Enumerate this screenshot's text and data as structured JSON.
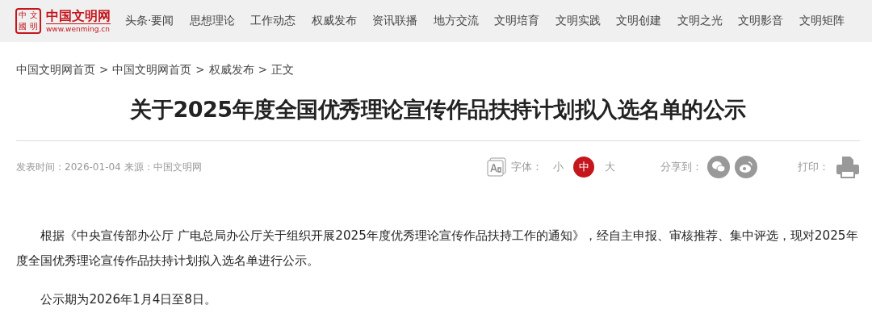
{
  "logo": {
    "seal": [
      "中",
      "文",
      "國",
      "明"
    ],
    "name": "中国文明网",
    "url": "www.wenming.cn"
  },
  "nav": [
    "头条·要闻",
    "思想理论",
    "工作动态",
    "权威发布",
    "资讯联播",
    "地方交流",
    "文明培育",
    "文明实践",
    "文明创建",
    "文明之光",
    "文明影音",
    "文明矩阵"
  ],
  "breadcrumb": [
    "中国文明网首页",
    "中国文明网首页",
    "权威发布",
    "正文"
  ],
  "breadcrumb_separator": ">",
  "title": "关于2025年度全国优秀理论宣传作品扶持计划拟入选名单的公示",
  "meta": "发表时间：2026-01-04 来源：中国文明网",
  "font_size": {
    "label": "字体：",
    "options": [
      {
        "label": "小",
        "selected": false
      },
      {
        "label": "中",
        "selected": true
      },
      {
        "label": "大",
        "selected": false
      }
    ]
  },
  "share": {
    "label": "分享到："
  },
  "print": {
    "label": "打印："
  },
  "paragraphs": [
    "根据《中央宣传部办公厅 广电总局办公厅关于组织开展2025年度优秀理论宣传作品扶持工作的通知》，经自主申报、审核推荐、集中评选，现对2025年度全国优秀理论宣传作品扶持计划拟入选名单进行公示。",
    "公示期为2026年1月4日至8日。"
  ]
}
